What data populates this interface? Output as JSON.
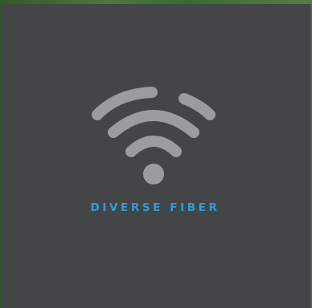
{
  "logo": {
    "icon": "wifi-icon",
    "wordmark": "DIVERSE FIBER",
    "colors": {
      "background": "#444547",
      "icon": "#9c9c9e",
      "text": "#2b9fd8"
    }
  }
}
